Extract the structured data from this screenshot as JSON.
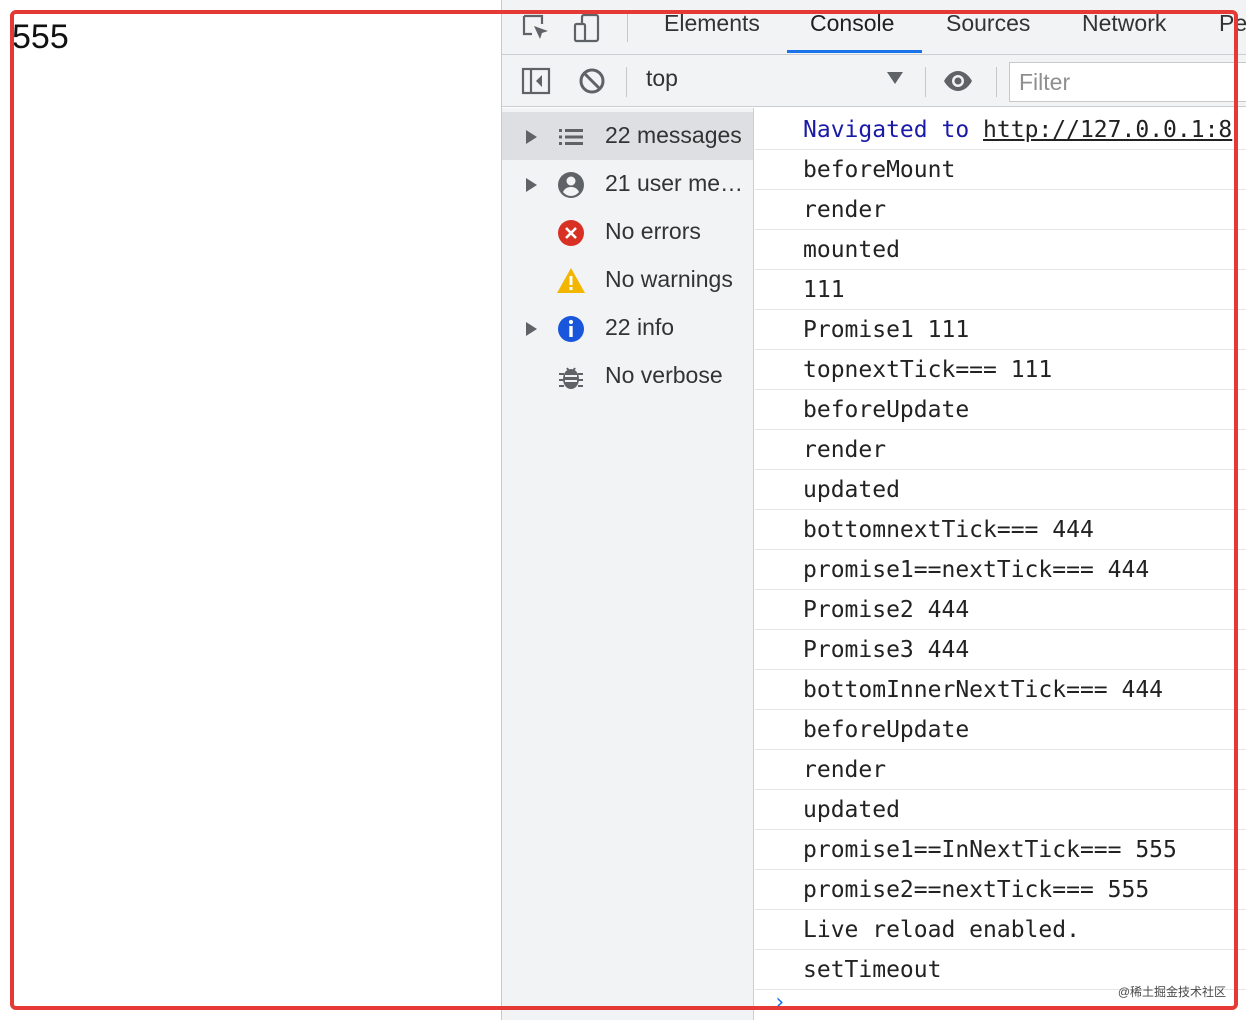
{
  "page": {
    "body_text": "555"
  },
  "devtools": {
    "tabs": [
      "Elements",
      "Console",
      "Sources",
      "Network",
      "Pe"
    ],
    "active_tab": "Console",
    "toolbar": {
      "context": "top",
      "filter_placeholder": "Filter"
    },
    "sidebar": {
      "items": [
        {
          "label": "22 messages",
          "icon": "list-icon",
          "expandable": true,
          "selected": true
        },
        {
          "label": "21 user me…",
          "icon": "user-icon",
          "expandable": true,
          "selected": false
        },
        {
          "label": "No errors",
          "icon": "error-icon",
          "expandable": false,
          "selected": false
        },
        {
          "label": "No warnings",
          "icon": "warning-icon",
          "expandable": false,
          "selected": false
        },
        {
          "label": "22 info",
          "icon": "info-icon",
          "expandable": true,
          "selected": false
        },
        {
          "label": "No verbose",
          "icon": "bug-icon",
          "expandable": false,
          "selected": false
        }
      ]
    },
    "console": {
      "navigated_prefix": "Navigated to",
      "navigated_url": "http://127.0.0.1:8",
      "messages": [
        "beforeMount",
        "render",
        "mounted",
        "111",
        "Promise1 111",
        "topnextTick=== 111",
        "beforeUpdate",
        "render",
        "updated",
        "bottomnextTick=== 444",
        "promise1==nextTick=== 444",
        "Promise2 444",
        "Promise3 444",
        "bottomInnerNextTick=== 444",
        "beforeUpdate",
        "render",
        "updated",
        "promise1==InNextTick=== 555",
        "promise2==nextTick=== 555",
        "Live reload enabled.",
        "setTimeout"
      ],
      "prompt": "›"
    }
  },
  "watermark": "@稀土掘金技术社区",
  "colors": {
    "highlight": "#e53935",
    "accent": "#1a73e8",
    "error": "#d93025",
    "warning": "#f2b600",
    "info": "#1a73e8"
  }
}
